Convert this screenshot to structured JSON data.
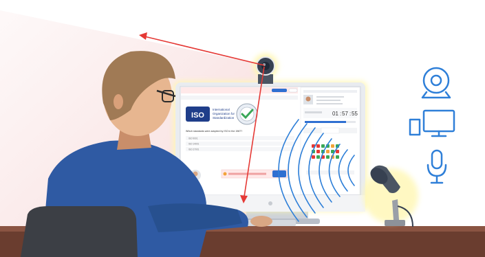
{
  "scene": {
    "iso_logo": {
      "abbr": "ISO",
      "name_lines": [
        "International",
        "Organization for",
        "Standardization"
      ]
    },
    "screen": {
      "header_button_primary": "",
      "header_button_secondary": "",
      "timer": {
        "hours": "01",
        "minutes": "57",
        "seconds": "55"
      },
      "question_text": "Which standards were adopted by ISO in the 1987?",
      "answers": [
        "ISO 9001",
        "ISO 14001",
        "ISO 27001"
      ],
      "warning_text": "",
      "bottom_button": ""
    },
    "colors": {
      "accent_red": "#e53935",
      "accent_blue": "#2f6fd1",
      "icon_blue": "#2e7fd8",
      "desk": "#6a3d2f",
      "sweater": "#2f5aa3",
      "hair": "#a07a55"
    },
    "icons": [
      "webcam-icon",
      "desktop-computer-icon",
      "microphone-icon"
    ]
  }
}
